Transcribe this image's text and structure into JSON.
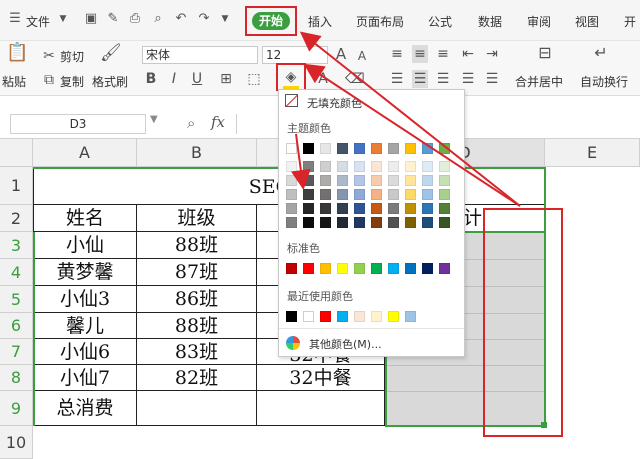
{
  "menu": {
    "file": "文件",
    "tabs": [
      "开始",
      "插入",
      "页面布局",
      "公式",
      "数据",
      "审阅",
      "视图",
      "开"
    ]
  },
  "ribbon": {
    "paste": "粘贴",
    "cut": "剪切",
    "copy": "复制",
    "format_painter": "格式刷",
    "font_name": "宋体",
    "font_size": "12",
    "bold": "B",
    "italic": "I",
    "underline": "U",
    "font_grow": "A",
    "font_shrink": "A",
    "merge_center": "合并居中",
    "wrap_text": "自动换行"
  },
  "formula_bar": {
    "name_box": "D3",
    "fx": "fx"
  },
  "sheet": {
    "columns": [
      "A",
      "B",
      "C",
      "D",
      "E"
    ],
    "rows": [
      "1",
      "2",
      "3",
      "4",
      "5",
      "6",
      "7",
      "8",
      "9",
      "10"
    ],
    "title_visible": "SEO优化",
    "headers": [
      "姓名",
      "班级",
      "",
      "计"
    ],
    "data": [
      [
        "小仙",
        "88班"
      ],
      [
        "黄梦馨",
        "87班"
      ],
      [
        "小仙3",
        "86班"
      ],
      [
        "馨儿",
        "88班"
      ],
      [
        "小仙6",
        "83班"
      ],
      [
        "小仙7",
        "82班"
      ]
    ],
    "c7_partial": "32中餐",
    "c8": "32中餐",
    "a9": "总消费"
  },
  "color_dropdown": {
    "no_fill": "无填充颜色",
    "theme_colors": "主题颜色",
    "standard_colors": "标准色",
    "recent_colors": "最近使用颜色",
    "more_colors": "其他颜色(M)...",
    "theme_top": [
      "#ffffff",
      "#000000",
      "#e7e6e6",
      "#44546a",
      "#4472c4",
      "#ed7d31",
      "#a5a5a5",
      "#ffc000",
      "#5b9bd5",
      "#70ad47"
    ],
    "theme_shades": [
      [
        "#f2f2f2",
        "#7f7f7f",
        "#d0cece",
        "#d6dce4",
        "#d9e2f3",
        "#fbe5d5",
        "#ededed",
        "#fff2cc",
        "#deebf6",
        "#e2efd9"
      ],
      [
        "#d8d8d8",
        "#595959",
        "#aeabab",
        "#adb9ca",
        "#b4c6e7",
        "#f7cbac",
        "#dbdbdb",
        "#fee599",
        "#bdd7ee",
        "#c5e0b3"
      ],
      [
        "#bfbfbf",
        "#3f3f3f",
        "#757070",
        "#8496b0",
        "#8eaadb",
        "#f4b183",
        "#c9c9c9",
        "#ffd965",
        "#9dc3e6",
        "#a8d08d"
      ],
      [
        "#a5a5a5",
        "#262626",
        "#3a3838",
        "#323f4f",
        "#2f5496",
        "#c55a11",
        "#7b7b7b",
        "#bf9000",
        "#2e75b5",
        "#538135"
      ],
      [
        "#7f7f7f",
        "#0c0c0c",
        "#171616",
        "#222a35",
        "#1f3864",
        "#833c0b",
        "#525252",
        "#7f6000",
        "#1e4e79",
        "#375623"
      ]
    ],
    "standard": [
      "#c00000",
      "#ff0000",
      "#ffc000",
      "#ffff00",
      "#92d050",
      "#00b050",
      "#00b0f0",
      "#0070c0",
      "#002060",
      "#7030a0"
    ],
    "recent": [
      "#000000",
      "#ffffff",
      "#ff0000",
      "#00b0f0",
      "#fbe5d5",
      "#fff2cc",
      "#ffff00",
      "#9dc3e6"
    ]
  },
  "colors": {
    "accent_green": "#3b9e3f",
    "annotation_red": "#d9252a",
    "selection_gray": "#d9d9d9"
  }
}
